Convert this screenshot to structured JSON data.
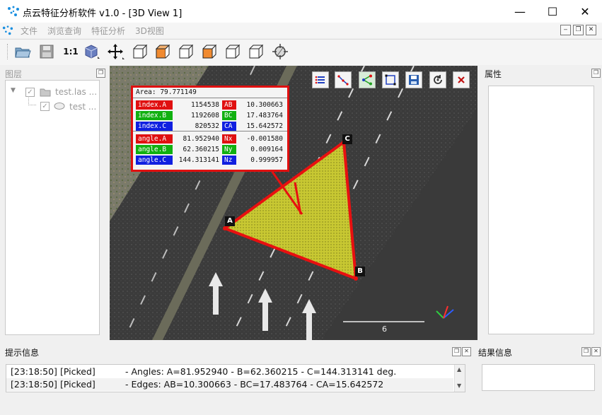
{
  "window": {
    "title": "点云特征分析软件 v1.0 - [3D View 1]",
    "minimize_glyph": "—",
    "maximize_glyph": "☐",
    "close_glyph": "✕"
  },
  "menu": {
    "items": [
      "文件",
      "浏览查询",
      "特征分析",
      "3D视图"
    ]
  },
  "toolbar": {
    "scale_label": "1:1",
    "icons": [
      "open-folder-icon",
      "save-icon",
      "scale-1-1-icon",
      "cube-view-icon",
      "pan-move-icon",
      "view-front-icon",
      "view-top-icon",
      "view-left-icon",
      "view-back-icon",
      "view-right-icon",
      "view-bottom-icon",
      "measure-target-icon"
    ]
  },
  "layers_panel": {
    "title": "图层",
    "items": [
      {
        "label": "test.las ..."
      },
      {
        "label": "test ..."
      }
    ]
  },
  "properties_panel": {
    "title": "属性"
  },
  "view3d": {
    "toolbar_icons": [
      "list-icon",
      "polyline-icon",
      "share-nodes-icon",
      "select-box-icon",
      "save-icon",
      "reset-icon",
      "close-icon"
    ],
    "area_text": "Area: 79.771149",
    "info_rows_top": [
      {
        "label": "index.A",
        "value": "1154538",
        "label2": "AB",
        "value2": "10.300663",
        "color": "#e01010"
      },
      {
        "label": "index.B",
        "value": "1192608",
        "label2": "BC",
        "value2": "17.483764",
        "color": "#10b010"
      },
      {
        "label": "index.C",
        "value": "820532",
        "label2": "CA",
        "value2": "15.642572",
        "color": "#1020e0"
      }
    ],
    "info_rows_bottom": [
      {
        "label": "angle.A",
        "value": "81.952940",
        "label2": "Nx",
        "value2": "-0.001580",
        "color": "#e01010"
      },
      {
        "label": "angle.B",
        "value": "62.360215",
        "label2": "Ny",
        "value2": "0.009164",
        "color": "#10b010"
      },
      {
        "label": "angle.C",
        "value": "144.313141",
        "label2": "Nz",
        "value2": "0.999957",
        "color": "#1020e0"
      }
    ],
    "point_labels": {
      "a": "A",
      "b": "B",
      "c": "C"
    },
    "scale_value": "6"
  },
  "hint_panel": {
    "title": "提示信息",
    "log": [
      {
        "time": "[23:18:50]",
        "tag": "[Picked]",
        "msg": "- Angles: A=81.952940 - B=62.360215 - C=144.313141 deg."
      },
      {
        "time": "[23:18:50]",
        "tag": "[Picked]",
        "msg": "- Edges: AB=10.300663 - BC=17.483764 - CA=15.642572"
      }
    ]
  },
  "result_panel": {
    "title": "结果信息"
  },
  "colors": {
    "triangle_edge": "#e81010",
    "triangle_fill": "#c8c832",
    "road": "#3a3a3a"
  }
}
